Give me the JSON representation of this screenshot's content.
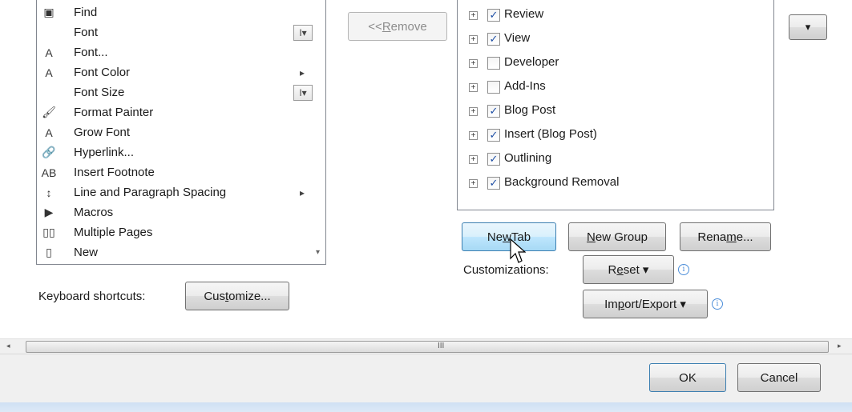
{
  "commands": [
    {
      "label": "Find",
      "icon": "binoculars-icon",
      "glyph": "▣",
      "extra": ""
    },
    {
      "label": "Font",
      "icon": "",
      "glyph": "",
      "extra": "combo"
    },
    {
      "label": "Font...",
      "icon": "font-dialog-icon",
      "glyph": "A",
      "extra": ""
    },
    {
      "label": "Font Color",
      "icon": "font-color-icon",
      "glyph": "A",
      "extra": "submenu"
    },
    {
      "label": "Font Size",
      "icon": "",
      "glyph": "",
      "extra": "combo"
    },
    {
      "label": "Format Painter",
      "icon": "paintbrush-icon",
      "glyph": "🖌",
      "extra": ""
    },
    {
      "label": "Grow Font",
      "icon": "grow-font-icon",
      "glyph": "A",
      "extra": ""
    },
    {
      "label": "Hyperlink...",
      "icon": "hyperlink-icon",
      "glyph": "🔗",
      "extra": ""
    },
    {
      "label": "Insert Footnote",
      "icon": "footnote-icon",
      "glyph": "AB",
      "extra": ""
    },
    {
      "label": "Line and Paragraph Spacing",
      "icon": "line-spacing-icon",
      "glyph": "↕",
      "extra": "submenu"
    },
    {
      "label": "Macros",
      "icon": "macros-icon",
      "glyph": "▶",
      "extra": ""
    },
    {
      "label": "Multiple Pages",
      "icon": "multiple-pages-icon",
      "glyph": "▯▯",
      "extra": ""
    },
    {
      "label": "New",
      "icon": "new-document-icon",
      "glyph": "▯",
      "extra": ""
    }
  ],
  "combo_glyph": "I▾",
  "submenu_glyph": "▸",
  "remove_button": {
    "prefix": "<< ",
    "key": "R",
    "rest": "emove"
  },
  "keyboard_shortcuts_label": "Keyboard shortcuts:",
  "customize_button": {
    "pre": "Cus",
    "key": "t",
    "rest": "omize..."
  },
  "tabs": [
    {
      "label": "Review",
      "checked": true
    },
    {
      "label": "View",
      "checked": true
    },
    {
      "label": "Developer",
      "checked": false
    },
    {
      "label": "Add-Ins",
      "checked": false
    },
    {
      "label": "Blog Post",
      "checked": true
    },
    {
      "label": "Insert (Blog Post)",
      "checked": true
    },
    {
      "label": "Outlining",
      "checked": true
    },
    {
      "label": "Background Removal",
      "checked": true
    }
  ],
  "expander_glyph": "+",
  "check_glyph": "✓",
  "new_tab_button": {
    "pre": "Ne",
    "key": "w",
    "rest": " Tab"
  },
  "new_group_button": {
    "pre": "",
    "key": "N",
    "rest": "ew Group"
  },
  "rename_button": {
    "pre": "Rena",
    "key": "m",
    "rest": "e..."
  },
  "customizations_label": "Customizations:",
  "reset_button": {
    "pre": "R",
    "key": "e",
    "rest": "set ▾"
  },
  "import_export_button": {
    "pre": "Im",
    "key": "p",
    "rest": "ort/Export ▾"
  },
  "info_glyph": "i",
  "dropdown_glyph": "▾",
  "ok_label": "OK",
  "cancel_label": "Cancel",
  "scroll_grip": "III",
  "scroll_left": "◂",
  "scroll_right": "▸"
}
